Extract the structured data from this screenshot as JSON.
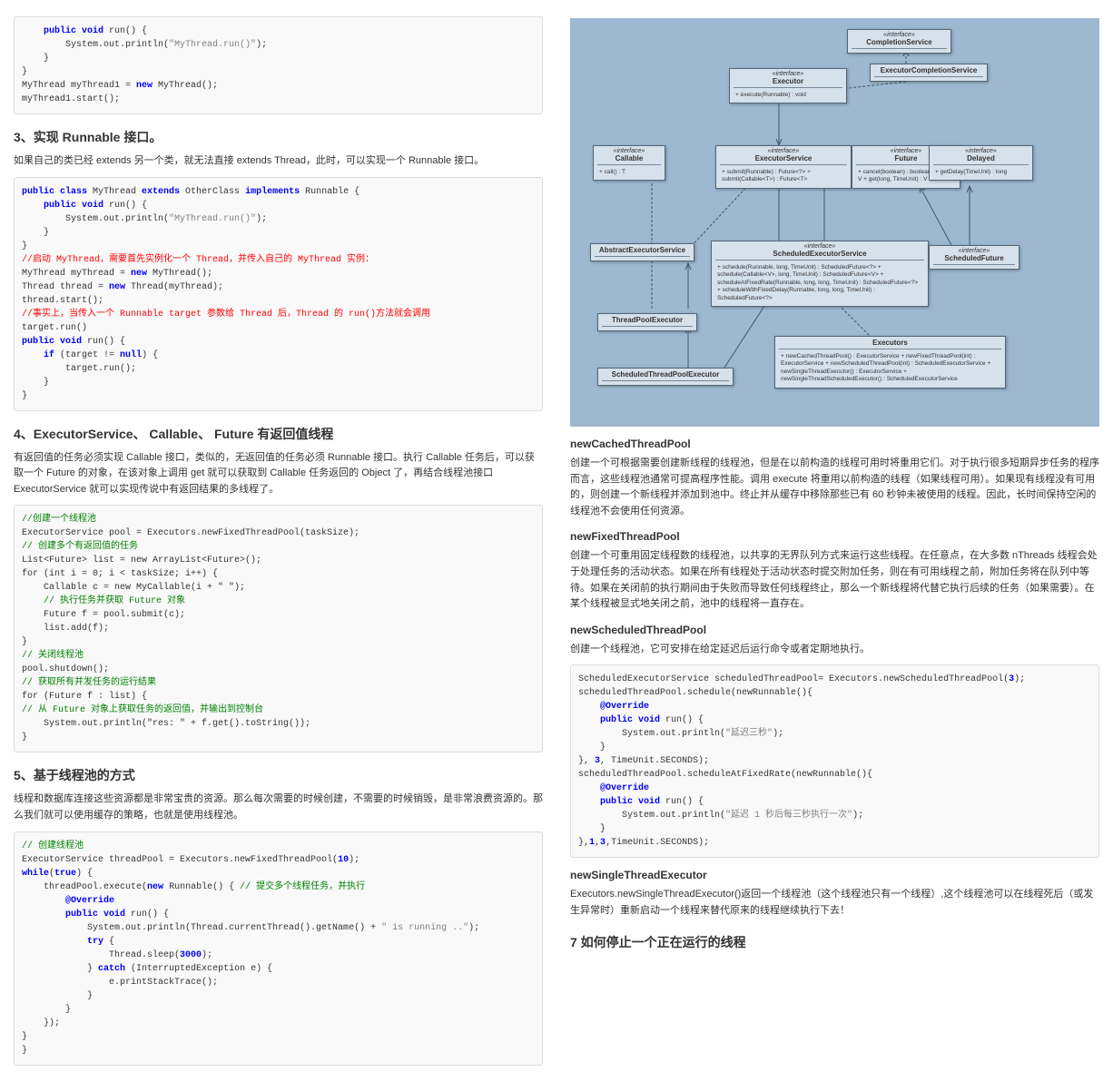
{
  "col1": {
    "code1": "    public void run() {\n        System.out.println(\"MyThread.run()\");\n    }\n}\nMyThread myThread1 = new MyThread();\nmyThread1.start();",
    "h3_1": "3、实现 Runnable 接口。",
    "p1": "如果自己的类已经 extends 另一个类，就无法直接 extends Thread，此时，可以实现一个 Runnable 接口。",
    "code2_a": "public class MyThread extends OtherClass implements Runnable {\n    public void run() {\n        System.out.println(\"MyThread.run()\");\n    }\n}",
    "code2_b": "//启动 MyThread，需要首先实例化一个 Thread，并传入自己的 MyThread 实例：",
    "code2_c": "MyThread myThread = new MyThread();\nThread thread = new Thread(myThread);\nthread.start();",
    "code2_d": "//事实上，当传入一个 Runnable target 参数给 Thread 后，Thread 的 run()方法就会调用",
    "code2_e": "target.run()\npublic void run() {\n    if (target != null) {\n        target.run();\n    }\n}",
    "h3_2": "4、ExecutorService、 Callable、 Future 有返回值线程",
    "p2": "有返回值的任务必须实现 Callable 接口，类似的，无返回值的任务必须 Runnable 接口。执行 Callable 任务后，可以获取一个 Future 的对象，在该对象上调用 get 就可以获取到 Callable 任务返回的 Object 了，再结合线程池接口 ExecutorService 就可以实现传说中有返回结果的多线程了。",
    "code3": [
      {
        "t": "cmt",
        "v": "//创建一个线程池"
      },
      {
        "t": "",
        "v": "ExecutorService pool = Executors.newFixedThreadPool(taskSize);"
      },
      {
        "t": "cmt",
        "v": "// 创建多个有返回值的任务"
      },
      {
        "t": "",
        "v": "List<Future> list = new ArrayList<Future>();"
      },
      {
        "t": "",
        "v": "for (int i = 0; i < taskSize; i++) {"
      },
      {
        "t": "",
        "v": "    Callable c = new MyCallable(i + \" \");"
      },
      {
        "t": "cmt",
        "v": "    // 执行任务并获取 Future 对象"
      },
      {
        "t": "",
        "v": "    Future f = pool.submit(c);"
      },
      {
        "t": "",
        "v": "    list.add(f);"
      },
      {
        "t": "",
        "v": "}"
      },
      {
        "t": "cmt",
        "v": "// 关闭线程池"
      },
      {
        "t": "",
        "v": "pool.shutdown();"
      },
      {
        "t": "cmt",
        "v": "// 获取所有并发任务的运行结果"
      },
      {
        "t": "",
        "v": "for (Future f : list) {"
      },
      {
        "t": "cmt",
        "v": "// 从 Future 对象上获取任务的返回值，并输出到控制台"
      },
      {
        "t": "",
        "v": "    System.out.println(\"res: \" + f.get().toString());"
      },
      {
        "t": "",
        "v": "}"
      }
    ],
    "h3_3": "5、基于线程池的方式",
    "p3": "线程和数据库连接这些资源都是非常宝贵的资源。那么每次需要的时候创建，不需要的时候销毁，是非常浪费资源的。那么我们就可以使用缓存的策略，也就是使用线程池。",
    "code4": "// 创建线程池\nExecutorService threadPool = Executors.newFixedThreadPool(10);\nwhile(true) {\n    threadPool.execute(new Runnable() { // 提交多个线程任务，并执行\n        @Override\n        public void run() {\n            System.out.println(Thread.currentThread().getName() + \" is running ..\");\n            try {\n                Thread.sleep(3000);\n            } catch (InterruptedException e) {\n                e.printStackTrace();\n            }\n        }\n    });\n}\n}"
  },
  "col2": {
    "uml": {
      "completionService": {
        "stereo": "«interface»",
        "name": "CompletionService"
      },
      "executor": {
        "stereo": "«interface»",
        "name": "Executor",
        "members": "+ execute(Runnable) : void"
      },
      "executorCompletionService": {
        "name": "ExecutorCompletionService"
      },
      "callable": {
        "stereo": "«interface»",
        "name": "Callable",
        "members": "+ call() : T"
      },
      "executorService": {
        "stereo": "«interface»",
        "name": "ExecutorService",
        "members": "+ submit(Runnable) : Future<?>\n+ submit(Callable<T>) : Future<T>"
      },
      "future": {
        "stereo": "«interface»",
        "name": "Future",
        "members": "+ cancel(boolean) : boolean\n+ get() : V\n+ get(long, TimeUnit) : V"
      },
      "delayed": {
        "stereo": "«interface»",
        "name": "Delayed",
        "members": "+ getDelay(TimeUnit) : long"
      },
      "abstractExecutorService": {
        "name": "AbstractExecutorService"
      },
      "scheduledExecutorService": {
        "stereo": "«interface»",
        "name": "ScheduledExecutorService",
        "members": "+ schedule(Runnable, long, TimeUnit) : ScheduledFuture<?>\n+ schedule(Callable<V>, long, TimeUnit) : ScheduledFuture<V>\n+ scheduleAtFixedRate(Runnable, long, long, TimeUnit) : ScheduledFuture<?>\n+ scheduleWithFixedDelay(Runnable, long, long, TimeUnit) : ScheduledFuture<?>"
      },
      "scheduledFuture": {
        "stereo": "«interface»",
        "name": "ScheduledFuture"
      },
      "threadPoolExecutor": {
        "name": "ThreadPoolExecutor"
      },
      "executors": {
        "name": "Executors",
        "members": "+ newCachedThreadPool() : ExecutorService\n+ newFixedThreadPool(int) : ExecutorService\n+ newScheduledThreadPool(int) : ScheduledExecutorService\n+ newSingleThreadExecutor() : ExecutorService\n+ newSingleThreadScheduledExecutor() : ScheduledExecutorService"
      },
      "scheduledThreadPoolExecutor": {
        "name": "ScheduledThreadPoolExecutor"
      }
    },
    "h4_1": "newCachedThreadPool",
    "p1": "创建一个可根据需要创建新线程的线程池，但是在以前构造的线程可用时将重用它们。对于执行很多短期异步任务的程序而言，这些线程池通常可提高程序性能。调用 execute 将重用以前构造的线程（如果线程可用）。如果现有线程没有可用的，则创建一个新线程并添加到池中。终止并从缓存中移除那些已有 60 秒钟未被使用的线程。因此，长时间保持空闲的线程池不会使用任何资源。",
    "h4_2": "newFixedThreadPool",
    "p2": "创建一个可重用固定线程数的线程池，以共享的无界队列方式来运行这些线程。在任意点，在大多数 nThreads 线程会处于处理任务的活动状态。如果在所有线程处于活动状态时提交附加任务，则在有可用线程之前，附加任务将在队列中等待。如果在关闭前的执行期间由于失败而导致任何线程终止，那么一个新线程将代替它执行后续的任务（如果需要）。在某个线程被显式地关闭之前，池中的线程将一直存在。",
    "h4_3": "newScheduledThreadPool",
    "p3": "创建一个线程池，它可安排在给定延迟后运行命令或者定期地执行。",
    "code1": "ScheduledExecutorService scheduledThreadPool= Executors.newScheduledThreadPool(3);\nscheduledThreadPool.schedule(newRunnable(){\n    @Override\n    public void run() {\n        System.out.println(\"延迟三秒\");\n    }\n}, 3, TimeUnit.SECONDS);\nscheduledThreadPool.scheduleAtFixedRate(newRunnable(){\n    @Override\n    public void run() {\n        System.out.println(\"延迟 1 秒后每三秒执行一次\");\n    }\n},1,3,TimeUnit.SECONDS);",
    "h4_4": "newSingleThreadExecutor",
    "p4": "Executors.newSingleThreadExecutor()返回一个线程池（这个线程池只有一个线程）,这个线程池可以在线程死后（或发生异常时）重新启动一个线程来替代原来的线程继续执行下去！",
    "h3_1": "7 如何停止一个正在运行的线程"
  }
}
